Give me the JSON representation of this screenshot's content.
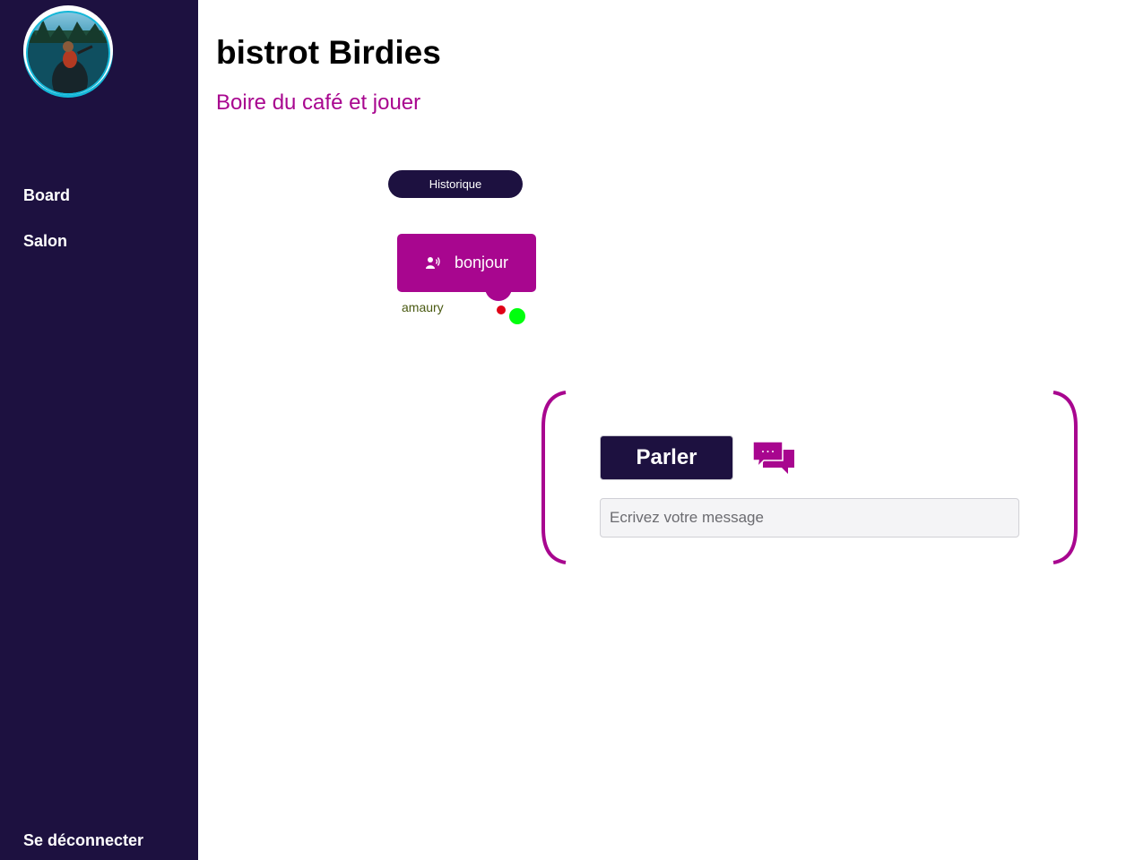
{
  "colors": {
    "sidebar_bg": "#1d1140",
    "accent": "#a8068f",
    "avatar_ring": "#14b7d8",
    "status_red": "#e00016",
    "status_green": "#00ff0d",
    "author_text": "#4a5a12"
  },
  "sidebar": {
    "items": [
      {
        "label": "Board"
      },
      {
        "label": "Salon"
      }
    ],
    "logout_label": "Se déconnecter"
  },
  "header": {
    "title": "bistrot Birdies",
    "subtitle": "Boire du café et jouer"
  },
  "history": {
    "button_label": "Historique"
  },
  "message": {
    "text": "bonjour",
    "author": "amaury",
    "icon": "speaker-user-icon"
  },
  "composer": {
    "speak_label": "Parler",
    "chat_icon": "chat-bubbles-icon",
    "placeholder": "Ecrivez votre message",
    "value": ""
  }
}
